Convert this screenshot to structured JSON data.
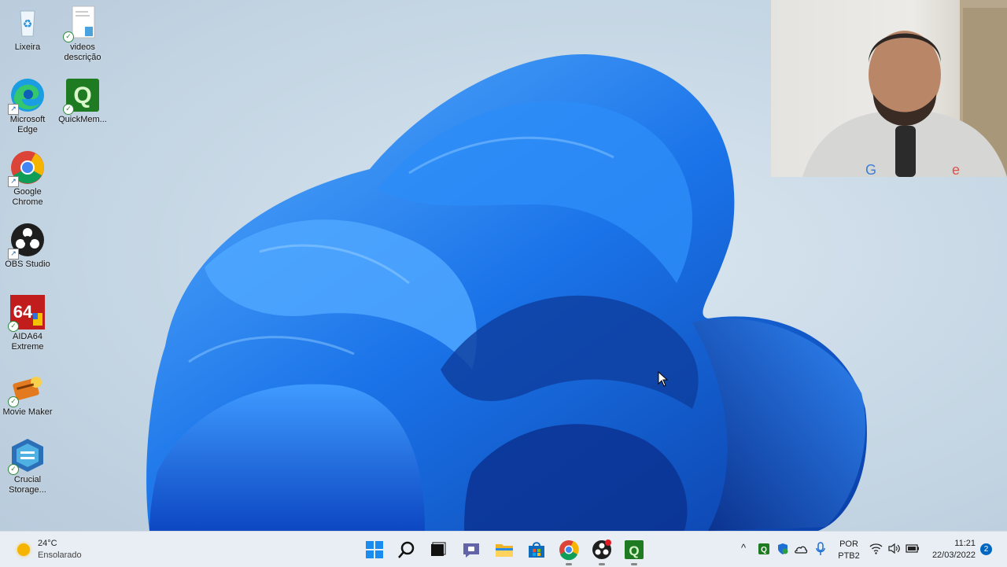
{
  "desktop": {
    "icons": [
      {
        "label": "Lixeira",
        "icon": "recycle-bin-icon"
      },
      {
        "label": "videos descrição",
        "icon": "document-icon"
      },
      {
        "label": "Microsoft Edge",
        "icon": "edge-icon"
      },
      {
        "label": "QuickMem...",
        "icon": "quickmem-icon"
      },
      {
        "label": "Google Chrome",
        "icon": "chrome-icon"
      },
      {
        "label": "OBS Studio",
        "icon": "obs-icon"
      },
      {
        "label": "AIDA64 Extreme",
        "icon": "aida64-icon"
      },
      {
        "label": "Movie Maker",
        "icon": "movie-maker-icon"
      },
      {
        "label": "Crucial Storage...",
        "icon": "crucial-icon"
      }
    ]
  },
  "taskbar": {
    "weather": {
      "temp": "24°C",
      "condition": "Ensolarado"
    },
    "pinned": [
      "start-icon",
      "search-icon",
      "task-view-icon",
      "chat-icon",
      "file-explorer-icon",
      "store-icon",
      "chrome-icon",
      "obs-icon",
      "quickmem-icon"
    ],
    "tray": {
      "lang_top": "POR",
      "lang_bottom": "PTB2",
      "time": "11:21",
      "date": "22/03/2022",
      "notifications": "2"
    }
  },
  "colors": {
    "accent": "#0067c0",
    "wallpaper_blue": "#1e6fe0"
  }
}
